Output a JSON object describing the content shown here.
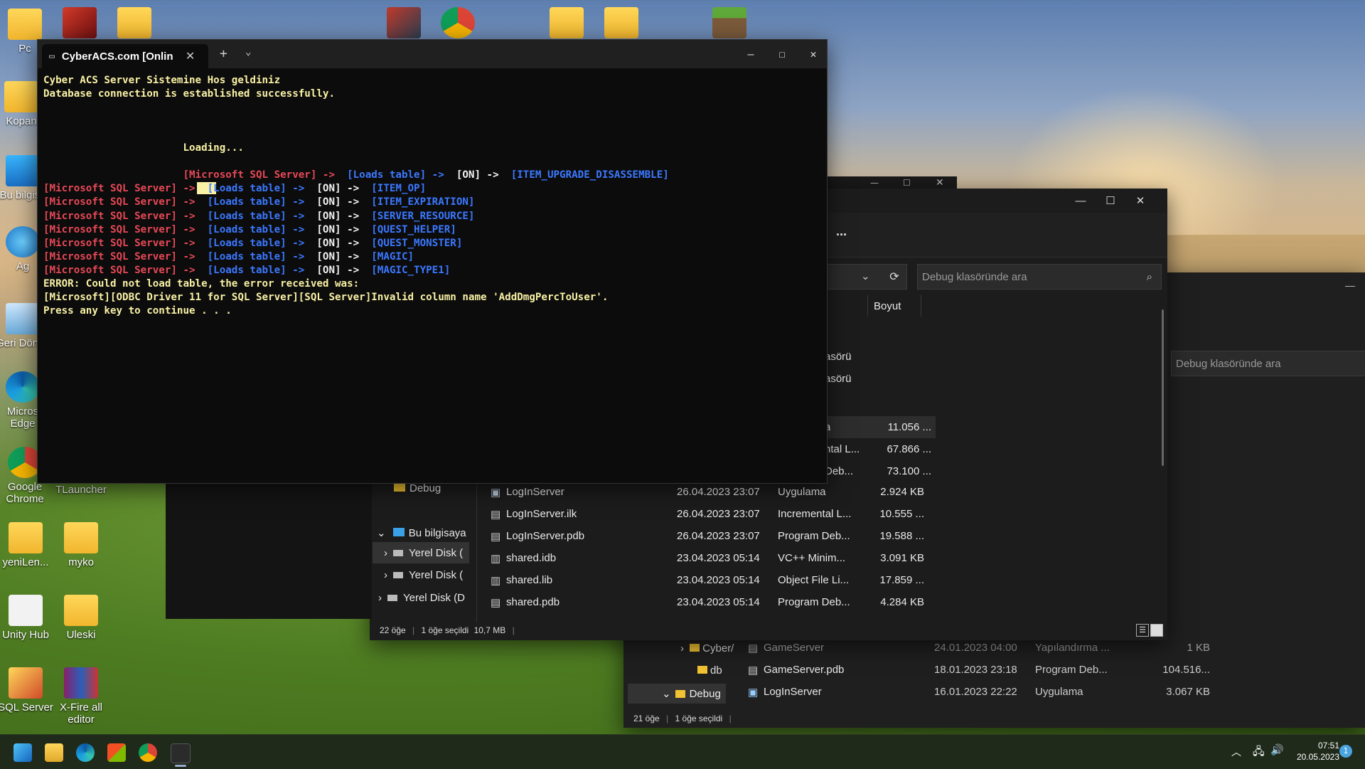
{
  "desktop": {
    "icons": [
      {
        "label": "Pc",
        "kind": "user-folder"
      },
      {
        "label": "Kopan",
        "kind": "folder"
      },
      {
        "label": "Bu bilgisa",
        "kind": "monitor"
      },
      {
        "label": "Ag",
        "kind": "network"
      },
      {
        "label": "Geri Dönüş",
        "kind": "recycle"
      },
      {
        "label": "Micros Edge",
        "kind": "edge"
      },
      {
        "label": "Google Chrome",
        "kind": "chrome"
      },
      {
        "label": "TLauncher",
        "kind": "blank"
      },
      {
        "label": "yeniLen...",
        "kind": "folder"
      },
      {
        "label": "myko",
        "kind": "folder"
      },
      {
        "label": "Unity Hub",
        "kind": "unity"
      },
      {
        "label": "Uleski",
        "kind": "folder"
      },
      {
        "label": "SQL Server",
        "kind": "sql"
      },
      {
        "label": "X-Fire all editor",
        "kind": "winrar"
      }
    ]
  },
  "terminal": {
    "tab_title": "CyberACS.com [Onlin",
    "lines": [
      {
        "segments": [
          {
            "t": "Cyber ACS Server Sistemine Hos geldiniz",
            "c": "yel"
          }
        ]
      },
      {
        "segments": [
          {
            "t": "Database connection is established successfully.",
            "c": "yel"
          }
        ]
      },
      {
        "segments": [
          {
            "t": "",
            "c": "yel"
          }
        ]
      },
      {
        "segments": [
          {
            "t": "",
            "c": "yel"
          }
        ]
      },
      {
        "segments": [
          {
            "t": "",
            "c": "yel"
          }
        ]
      },
      {
        "segments": [
          {
            "t": "                       Loading...",
            "c": "yel"
          }
        ]
      },
      {
        "segments": [
          {
            "t": "",
            "c": "yel"
          }
        ]
      },
      {
        "segments": [
          {
            "t": "                       ",
            "c": "yel"
          },
          {
            "t": "[Microsoft SQL Server] ->",
            "c": "red"
          },
          {
            "t": "  [Loads table] ->",
            "c": "blue"
          },
          {
            "t": "  [ON] ->",
            "c": "wht"
          },
          {
            "t": "  [ITEM_UPGRADE_DISASSEMBLE]",
            "c": "blue"
          }
        ]
      },
      {
        "segments": [
          {
            "t": "[Microsoft SQL Server] ->",
            "c": "red"
          },
          {
            "t": "  [Loads table] ->",
            "c": "blue"
          },
          {
            "t": "  [ON] ->",
            "c": "wht"
          },
          {
            "t": "  [ITEM_OP]",
            "c": "blue"
          }
        ]
      },
      {
        "segments": [
          {
            "t": "[Microsoft SQL Server] ->",
            "c": "red"
          },
          {
            "t": "  [Loads table] ->",
            "c": "blue"
          },
          {
            "t": "  [ON] ->",
            "c": "wht"
          },
          {
            "t": "  [ITEM_EXPIRATION]",
            "c": "blue"
          }
        ]
      },
      {
        "segments": [
          {
            "t": "[Microsoft SQL Server] ->",
            "c": "red"
          },
          {
            "t": "  [Loads table] ->",
            "c": "blue"
          },
          {
            "t": "  [ON] ->",
            "c": "wht"
          },
          {
            "t": "  [SERVER_RESOURCE]",
            "c": "blue"
          }
        ]
      },
      {
        "segments": [
          {
            "t": "[Microsoft SQL Server] ->",
            "c": "red"
          },
          {
            "t": "  [Loads table] ->",
            "c": "blue"
          },
          {
            "t": "  [ON] ->",
            "c": "wht"
          },
          {
            "t": "  [QUEST_HELPER]",
            "c": "blue"
          }
        ]
      },
      {
        "segments": [
          {
            "t": "[Microsoft SQL Server] ->",
            "c": "red"
          },
          {
            "t": "  [Loads table] ->",
            "c": "blue"
          },
          {
            "t": "  [ON] ->",
            "c": "wht"
          },
          {
            "t": "  [QUEST_MONSTER]",
            "c": "blue"
          }
        ]
      },
      {
        "segments": [
          {
            "t": "[Microsoft SQL Server] ->",
            "c": "red"
          },
          {
            "t": "  [Loads table] ->",
            "c": "blue"
          },
          {
            "t": "  [ON] ->",
            "c": "wht"
          },
          {
            "t": "  [MAGIC]",
            "c": "blue"
          }
        ]
      },
      {
        "segments": [
          {
            "t": "[Microsoft SQL Server] ->",
            "c": "red"
          },
          {
            "t": "  [Loads table] ->",
            "c": "blue"
          },
          {
            "t": "  [ON] ->",
            "c": "wht"
          },
          {
            "t": "  [MAGIC_TYPE1]",
            "c": "blue"
          }
        ]
      },
      {
        "segments": [
          {
            "t": "ERROR: Could not load table, the error received was:",
            "c": "yel"
          }
        ]
      },
      {
        "segments": [
          {
            "t": "[Microsoft][ODBC Driver 11 for SQL Server][SQL Server]Invalid column name 'AddDmgPercToUser'.",
            "c": "yel"
          }
        ]
      },
      {
        "segments": [
          {
            "t": "Press any key to continue . . .",
            "c": "yel"
          }
        ]
      }
    ]
  },
  "explorer_front": {
    "search_placeholder": "Debug klasöründe ara",
    "more_label": "...",
    "col_size": "Boyut",
    "partial_rows": [
      {
        "type": "asörü",
        "size": ""
      },
      {
        "type": "asörü",
        "size": ""
      },
      {
        "type": "a",
        "size": "11.056 ..."
      },
      {
        "type": "ntal L...",
        "size": "67.866 ..."
      },
      {
        "type": "Deb...",
        "size": "73.100 ..."
      }
    ],
    "files": [
      {
        "name": "LogInServer",
        "date": "26.04.2023 23:07",
        "type": "Uygulama",
        "size": "2.924 KB"
      },
      {
        "name": "LogInServer.ilk",
        "date": "26.04.2023 23:07",
        "type": "Incremental L...",
        "size": "10.555 ..."
      },
      {
        "name": "LogInServer.pdb",
        "date": "26.04.2023 23:07",
        "type": "Program Deb...",
        "size": "19.588 ..."
      },
      {
        "name": "shared.idb",
        "date": "23.04.2023 05:14",
        "type": "VC++ Minim...",
        "size": "3.091 KB"
      },
      {
        "name": "shared.lib",
        "date": "23.04.2023 05:14",
        "type": "Object File Li...",
        "size": "17.859 ..."
      },
      {
        "name": "shared.pdb",
        "date": "23.04.2023 05:14",
        "type": "Program Deb...",
        "size": "4.284 KB"
      }
    ],
    "nav": {
      "debug": "Debug",
      "this_pc": "Bu bilgisaya",
      "disk1": "Yerel Disk (",
      "disk2": "Yerel Disk (",
      "disk3": "Yerel Disk (D"
    },
    "status_count": "22 öğe",
    "status_selected": "1 öğe seçildi",
    "status_size": "10,7 MB"
  },
  "explorer_back": {
    "search_placeholder": "Debug klasöründe ara",
    "nav": {
      "item1": "Cyber/",
      "item2": "db",
      "item3": "Debug"
    },
    "files": [
      {
        "name": "GameServer",
        "date": "24.01.2023 04:00",
        "type": "Yapılandırma ...",
        "size": "1 KB"
      },
      {
        "name": "GameServer.pdb",
        "date": "18.01.2023 23:18",
        "type": "Program Deb...",
        "size": "104.516..."
      },
      {
        "name": "LogInServer",
        "date": "16.01.2023 22:22",
        "type": "Uygulama",
        "size": "3.067 KB"
      }
    ],
    "status_count": "21 öğe",
    "status_selected": "1 öğe seçildi"
  },
  "taskbar": {
    "time": "07:51",
    "date": "20.05.2023",
    "notification_count": "1"
  },
  "colors": {
    "terminal_bg": "#0c0c0c",
    "explorer_bg": "#1c1c1c",
    "red": "#e74856",
    "blue": "#3b78ff",
    "yellow": "#f9f1a5"
  }
}
